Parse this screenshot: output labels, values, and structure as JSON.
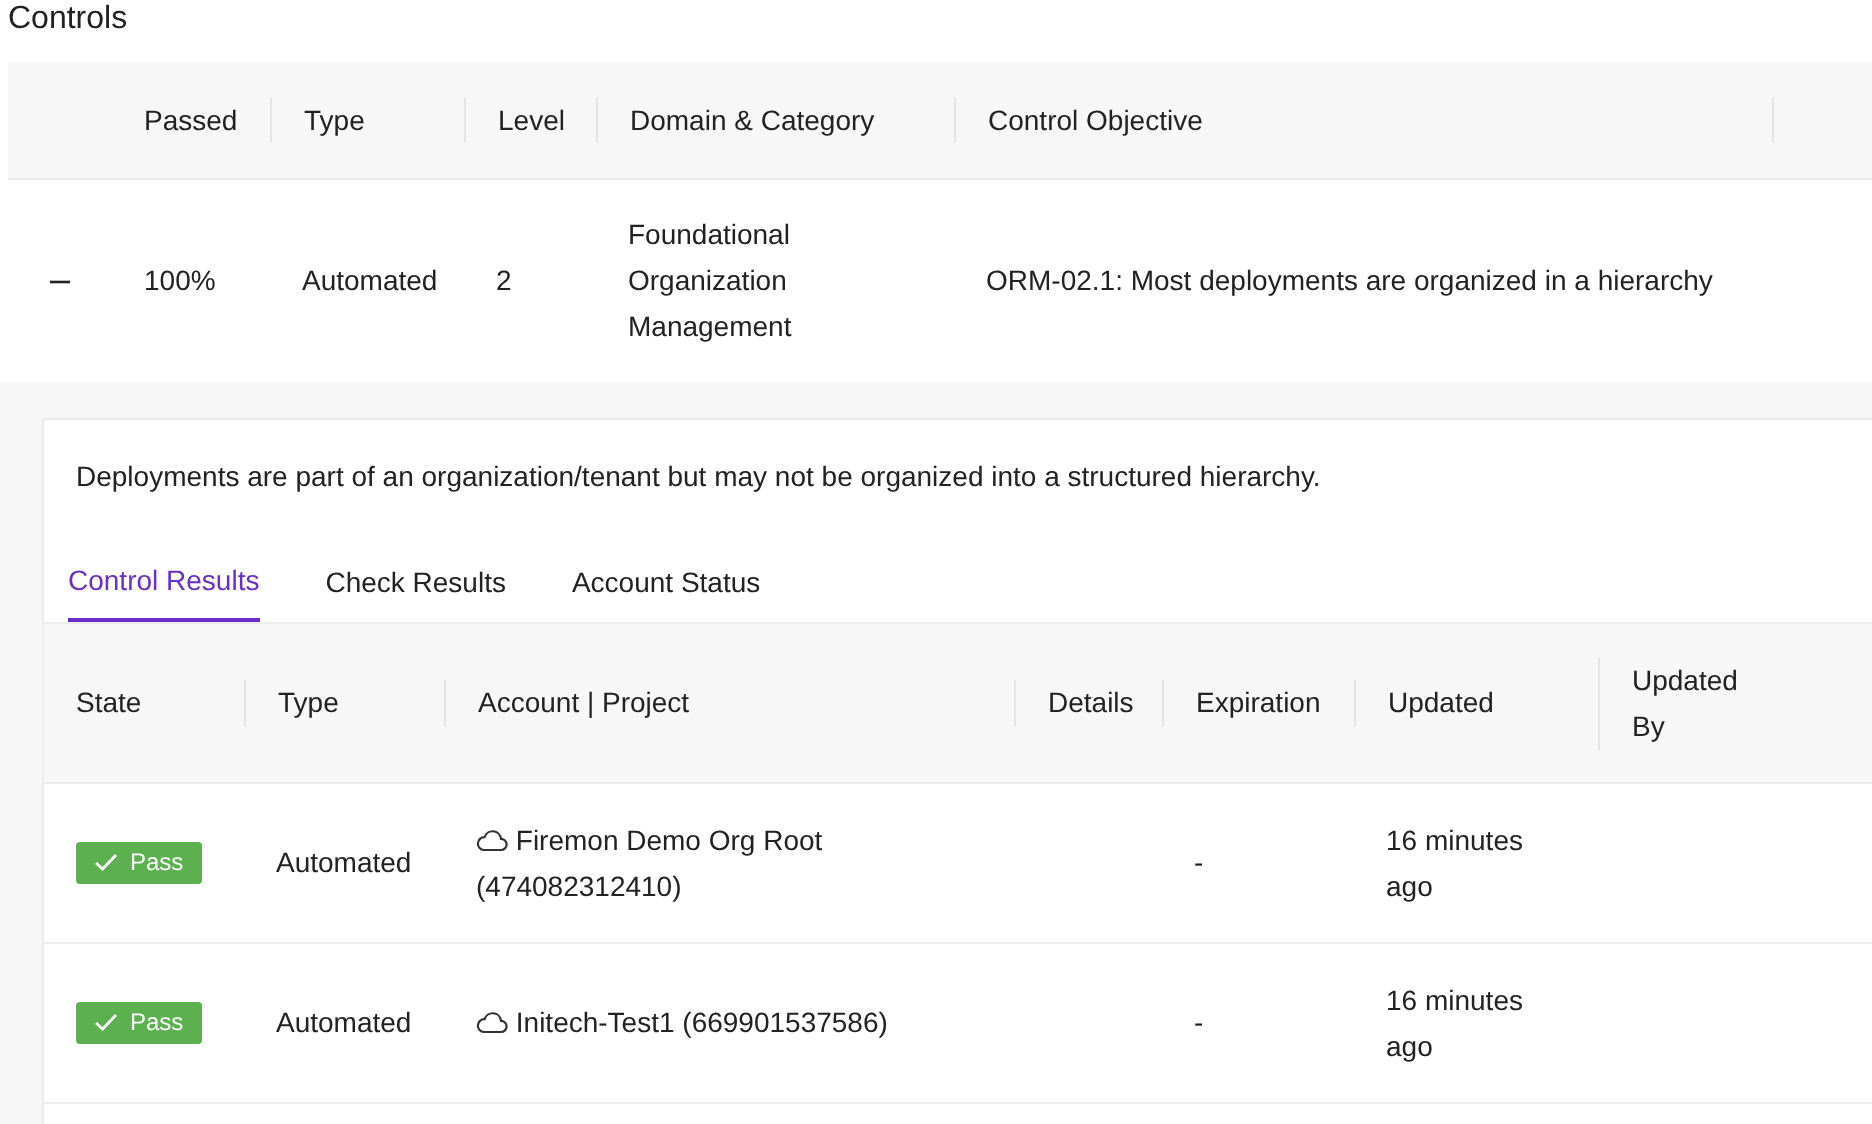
{
  "section_title": "Controls",
  "controls_table": {
    "columns": [
      "Passed",
      "Type",
      "Level",
      "Domain & Category",
      "Control Objective"
    ],
    "rows": [
      {
        "expanded": true,
        "passed": "100%",
        "type": "Automated",
        "level": "2",
        "domain": "Foundational Organization Management",
        "objective": "ORM-02.1: Most deployments are organized in a hierarchy"
      }
    ]
  },
  "detail": {
    "description": "Deployments are part of an organization/tenant but may not be organized into a structured hierarchy.",
    "tabs": [
      {
        "label": "Control Results",
        "selected": true
      },
      {
        "label": "Check Results",
        "selected": false
      },
      {
        "label": "Account Status",
        "selected": false
      }
    ],
    "results_table": {
      "columns": [
        "State",
        "Type",
        "Account | Project",
        "Details",
        "Expiration",
        "Updated",
        "Updated By"
      ],
      "rows": [
        {
          "state": "Pass",
          "type": "Automated",
          "account": "Firemon Demo Org Root (474082312410)",
          "expiration": "-",
          "updated": "16 minutes ago"
        },
        {
          "state": "Pass",
          "type": "Automated",
          "account": "Initech-Test1 (669901537586)",
          "expiration": "-",
          "updated": "16 minutes ago"
        }
      ]
    }
  }
}
